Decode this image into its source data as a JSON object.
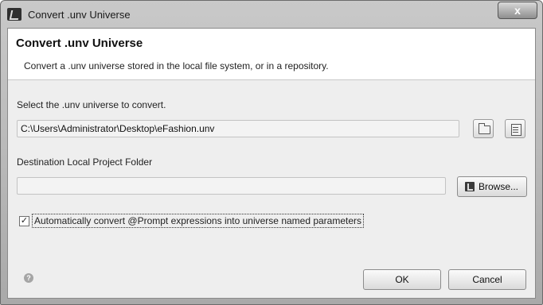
{
  "window": {
    "title": "Convert .unv Universe",
    "close_glyph": "x"
  },
  "header": {
    "title": "Convert .unv Universe",
    "description": "Convert a .unv universe stored in the local file system, or in a repository."
  },
  "source": {
    "label": "Select the .unv universe to convert.",
    "path_value": "C:\\Users\\Administrator\\Desktop\\eFashion.unv",
    "file_button_icon": "open-folder-icon",
    "repository_button_icon": "repository-icon"
  },
  "destination": {
    "label": "Destination Local Project Folder",
    "folder_value": "",
    "browse_label": "Browse..."
  },
  "options": {
    "convert_prompt_checked": true,
    "convert_prompt_label": "Automatically convert @Prompt expressions into universe named parameters"
  },
  "footer": {
    "help_icon": "help-icon",
    "ok_label": "OK",
    "cancel_label": "Cancel"
  }
}
